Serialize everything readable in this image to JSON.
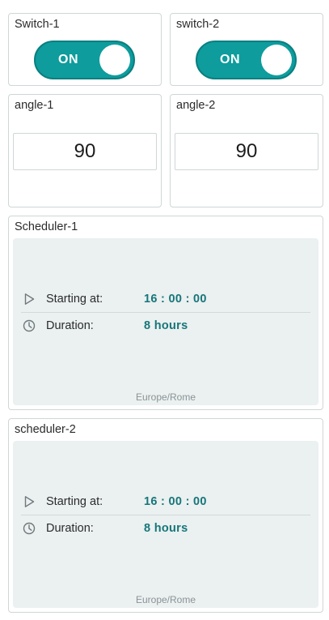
{
  "switch1": {
    "title": "Switch-1",
    "state": "ON"
  },
  "switch2": {
    "title": "switch-2",
    "state": "ON"
  },
  "angle1": {
    "title": "angle-1",
    "value": "90"
  },
  "angle2": {
    "title": "angle-2",
    "value": "90"
  },
  "scheduler1": {
    "title": "Scheduler-1",
    "start_label": "Starting at:",
    "start_value": "16 : 00 : 00",
    "duration_label": "Duration:",
    "duration_value": "8 hours",
    "timezone": "Europe/Rome"
  },
  "scheduler2": {
    "title": "scheduler-2",
    "start_label": "Starting at:",
    "start_value": "16 : 00 : 00",
    "duration_label": "Duration:",
    "duration_value": "8 hours",
    "timezone": "Europe/Rome"
  },
  "colors": {
    "accent": "#0e9c9d",
    "value_text": "#16767a",
    "panel_bg": "#ebf0f0"
  },
  "icons": {
    "start": "play-icon",
    "duration": "clock-icon"
  }
}
